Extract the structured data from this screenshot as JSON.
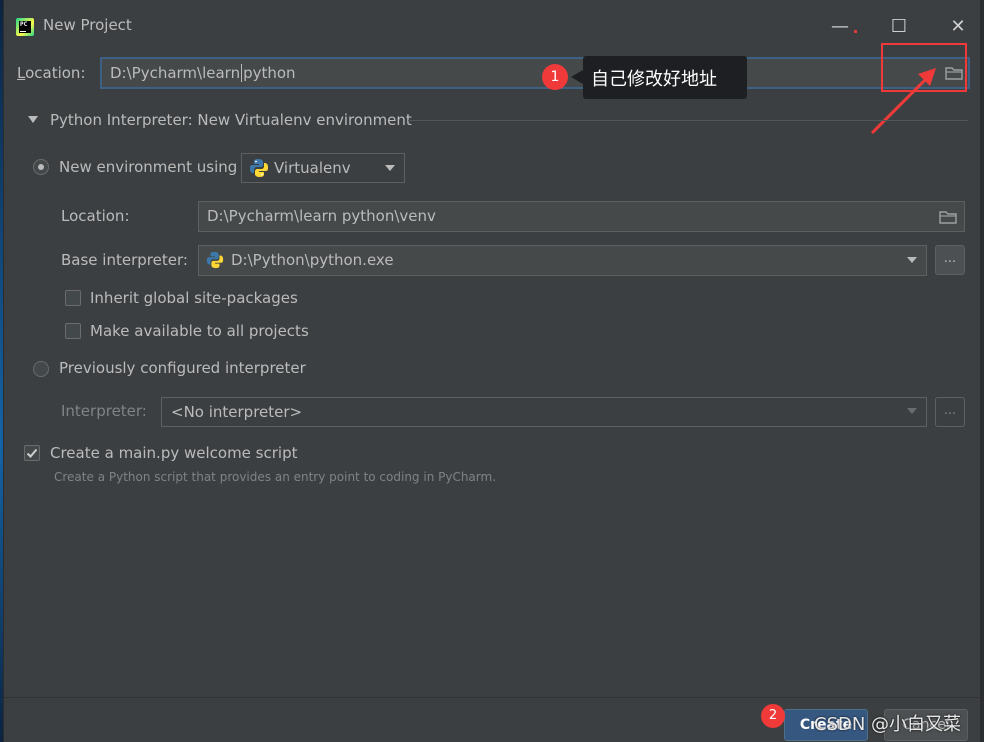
{
  "window": {
    "title": "New Project",
    "controls": {
      "minimize": "—",
      "maximize": "☐",
      "close": "✕"
    }
  },
  "project": {
    "location_label": "Location:",
    "location_value_prefix": "D:\\Pycharm\\learn",
    "location_value_suffix": "python"
  },
  "annotation": {
    "badge_1": "1",
    "note": "自己修改好地址",
    "badge_2": "2",
    "accent_color": "#f03a3a"
  },
  "interpreter_section": {
    "title": "Python Interpreter: New Virtualenv environment",
    "new_env_label": "New environment using",
    "env_tool": "Virtualenv",
    "venv_location_label": "Location:",
    "venv_location_value": "D:\\Pycharm\\learn python\\venv",
    "base_interpreter_label": "Base interpreter:",
    "base_interpreter_value": "D:\\Python\\python.exe",
    "more_button": "...",
    "inherit_label": "Inherit global site-packages",
    "available_label": "Make available to all projects",
    "previous_label": "Previously configured interpreter",
    "interpreter_label": "Interpreter:",
    "interpreter_value": "<No interpreter>"
  },
  "welcome": {
    "checkbox_label": "Create a main.py welcome script",
    "description": "Create a Python script that provides an entry point to coding in PyCharm."
  },
  "footer": {
    "create_label": "Create",
    "cancel_label": "Cancel",
    "watermark": "CSDN @小白又菜"
  },
  "icons": [
    "pycharm-logo-icon",
    "folder-icon",
    "python-icon",
    "chevron-down-icon",
    "triangle-down-icon",
    "check-icon"
  ]
}
